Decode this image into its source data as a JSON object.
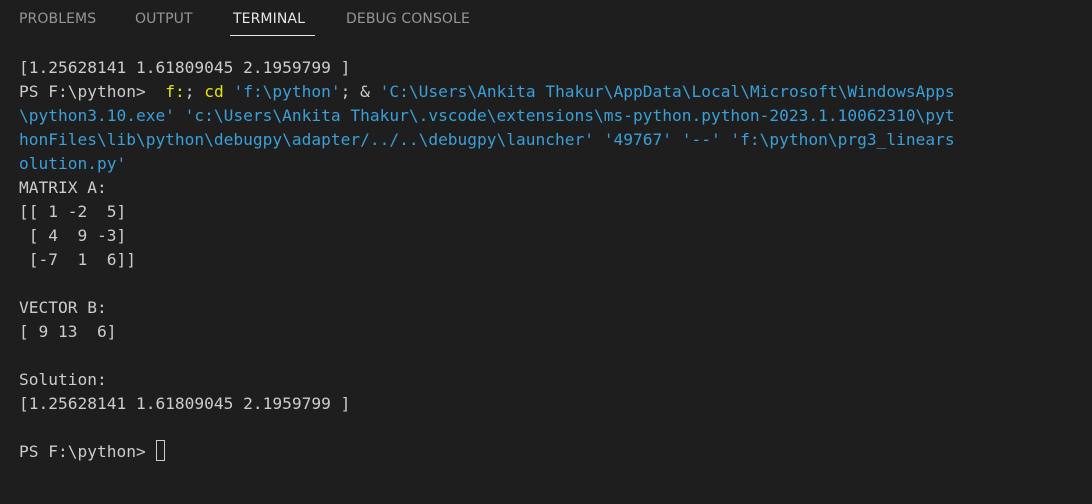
{
  "tabs": {
    "problems": "PROBLEMS",
    "output": "OUTPUT",
    "terminal": "TERMINAL",
    "debug_console": "DEBUG CONSOLE",
    "active": "TERMINAL"
  },
  "terminal": {
    "first_output": "[1.25628141 1.61809045 2.1959799 ]",
    "prompt": "PS F:\\python> ",
    "cmd_f": " f:",
    "cmd_sep": "; ",
    "cmd_cd": "cd",
    "cmd_path": " 'f:\\python'",
    "cmd_amp": "; & ",
    "cmd_exe_line1": "'C:\\Users\\Ankita Thakur\\AppData\\Local\\Microsoft\\WindowsApps",
    "cmd_line2": "\\python3.10.exe' 'c:\\Users\\Ankita Thakur\\.vscode\\extensions\\ms-python.python-2023.1.10062310\\pyt",
    "cmd_line3": "honFiles\\lib\\python\\debugpy\\adapter/../..\\debugpy\\launcher' '49767' '--' 'f:\\python\\prg3_linears",
    "cmd_line4": "olution.py'",
    "matrix_label": "MATRIX A:",
    "matrix_rows": [
      "[[ 1 -2  5]",
      " [ 4  9 -3]",
      " [-7  1  6]]"
    ],
    "vector_label": "VECTOR B:",
    "vector_value": "[ 9 13  6]",
    "solution_label": "Solution:",
    "solution_value": "[1.25628141 1.61809045 2.1959799 ]",
    "final_prompt": "PS F:\\python> "
  },
  "colors": {
    "background": "#1e1e1e",
    "text": "#cccccc",
    "command_yellow": "#e5e510",
    "string_cyan": "#3b9fd8",
    "tab_inactive": "#969696",
    "tab_active": "#e7e7e7"
  }
}
